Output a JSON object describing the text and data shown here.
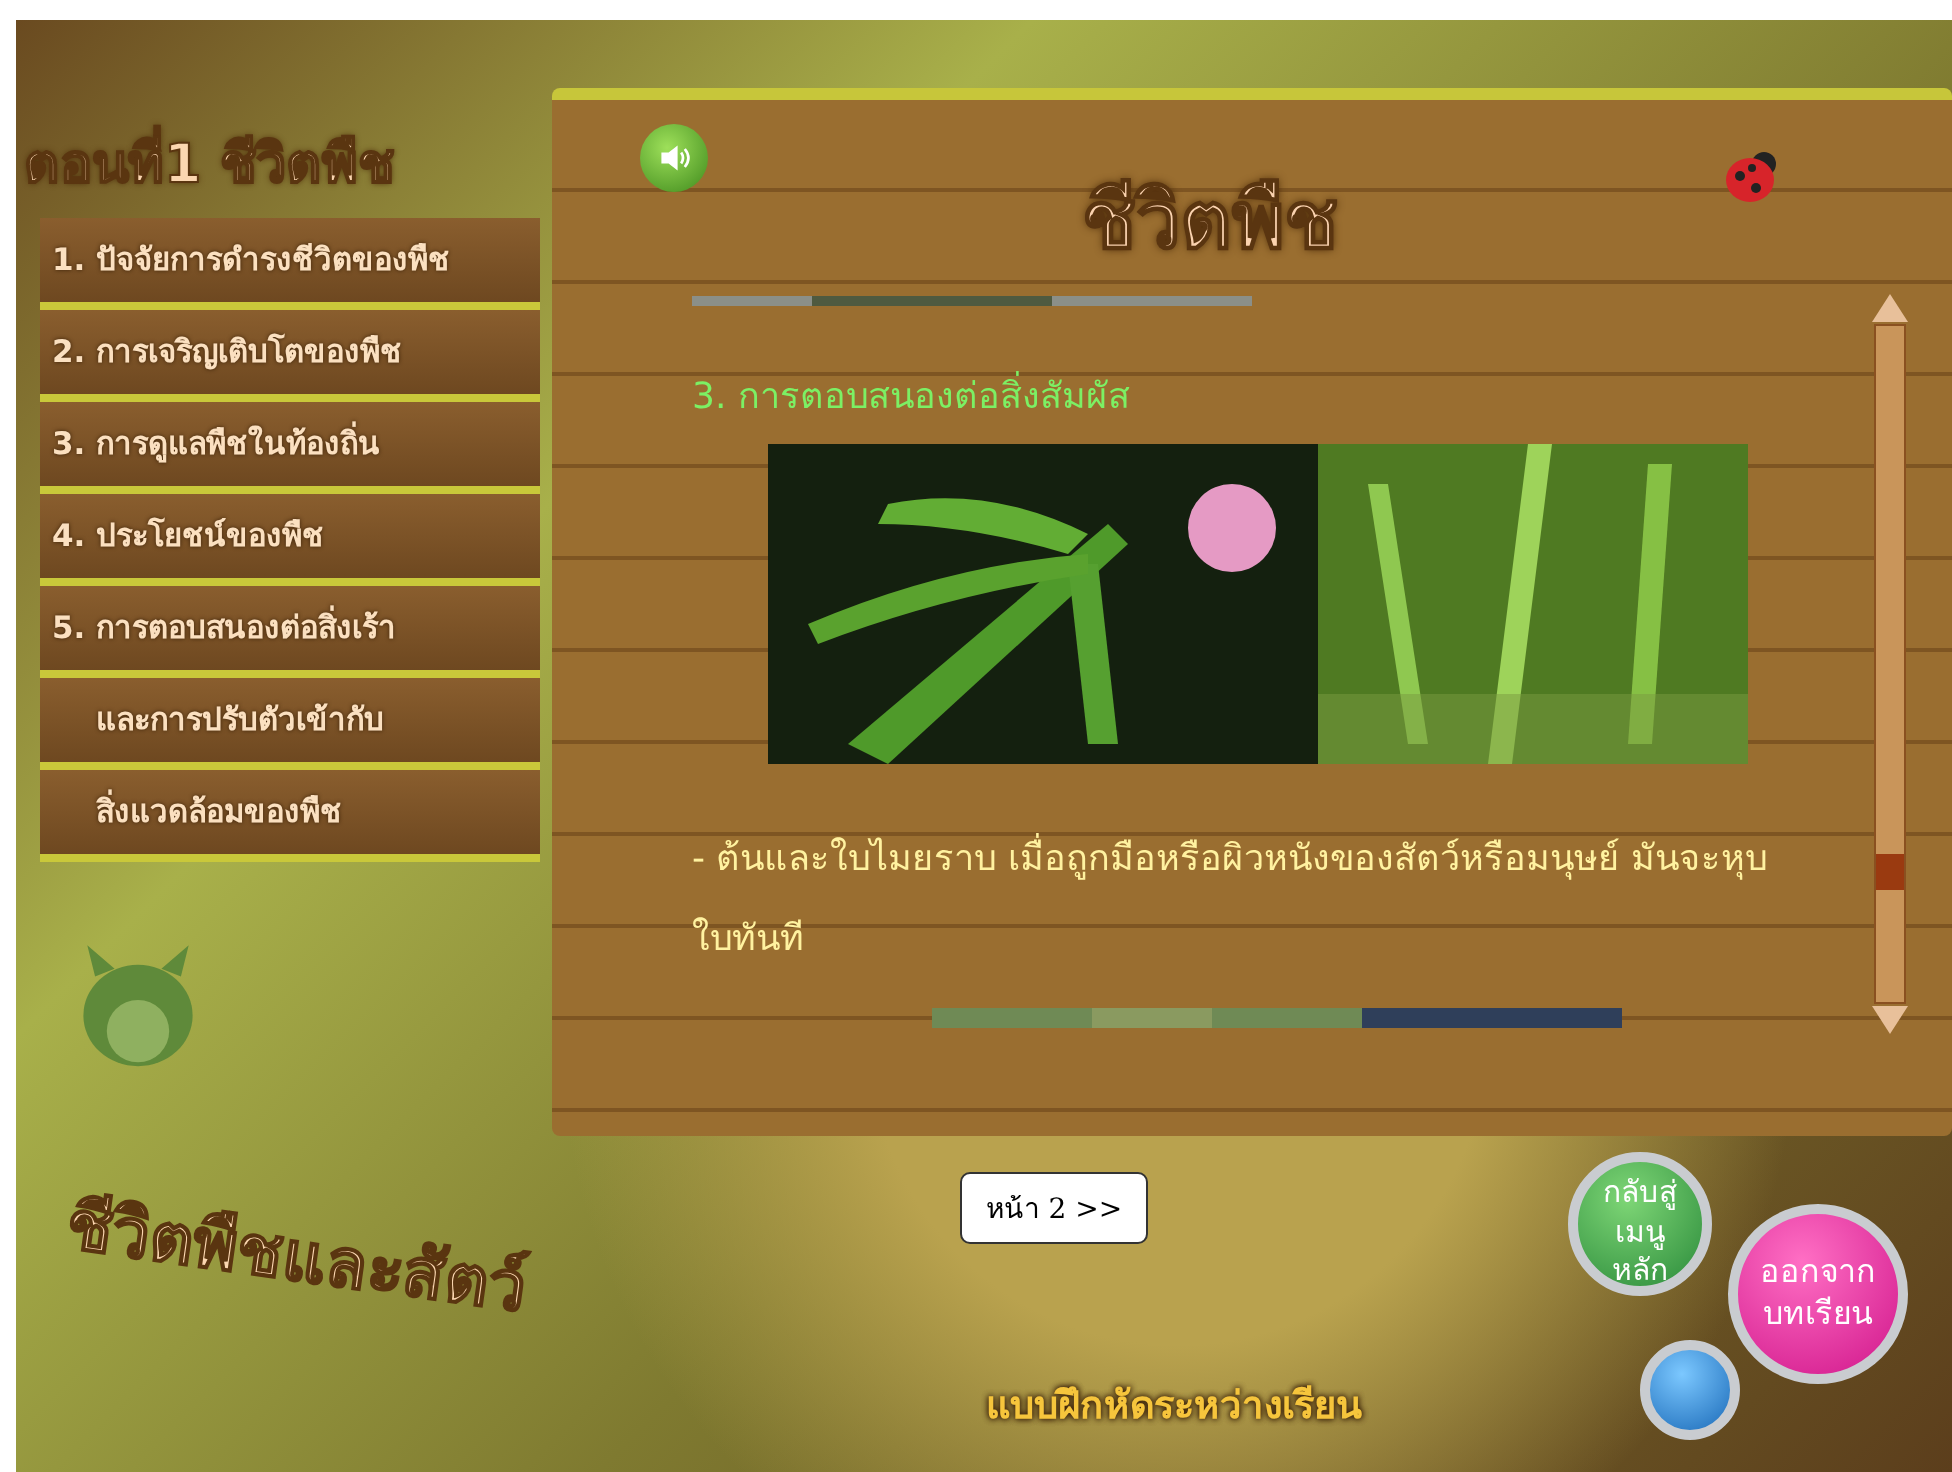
{
  "sidebar": {
    "title": "ตอนที่1 ชีวิตพืช",
    "items": [
      {
        "lines": [
          "1. ปัจจัยการดำรงชีวิตของพืช"
        ]
      },
      {
        "lines": [
          "2. การเจริญเติบโตของพืช"
        ]
      },
      {
        "lines": [
          "3. การดูแลพืชในท้องถิ่น"
        ]
      },
      {
        "lines": [
          "4. ประโยชน์ของพืช"
        ]
      },
      {
        "lines": [
          "5. การตอบสนองต่อสิ่งเร้า",
          "และการปรับตัวเข้ากับ",
          "สิ่งแวดล้อมของพืช"
        ]
      }
    ]
  },
  "content": {
    "heading": "ชีวิตพืช",
    "section": "3. การตอบสนองต่อสิ่งสัมผัส",
    "paragraph": "- ต้นและใบไมยราบ เมื่อถูกมือหรือผิวหนังของสัตว์หรือมนุษย์ มันจะหุบใบทันที"
  },
  "pager": {
    "label": "หน้า 2 >>"
  },
  "footer": {
    "logo": "ชีวิตพืชและสัตว์",
    "exercise": "แบบฝึกหัดระหว่างเรียน",
    "menu_button": "กลับสู่ เมนูหลัก",
    "exit_button": "ออกจาก บทเรียน"
  }
}
